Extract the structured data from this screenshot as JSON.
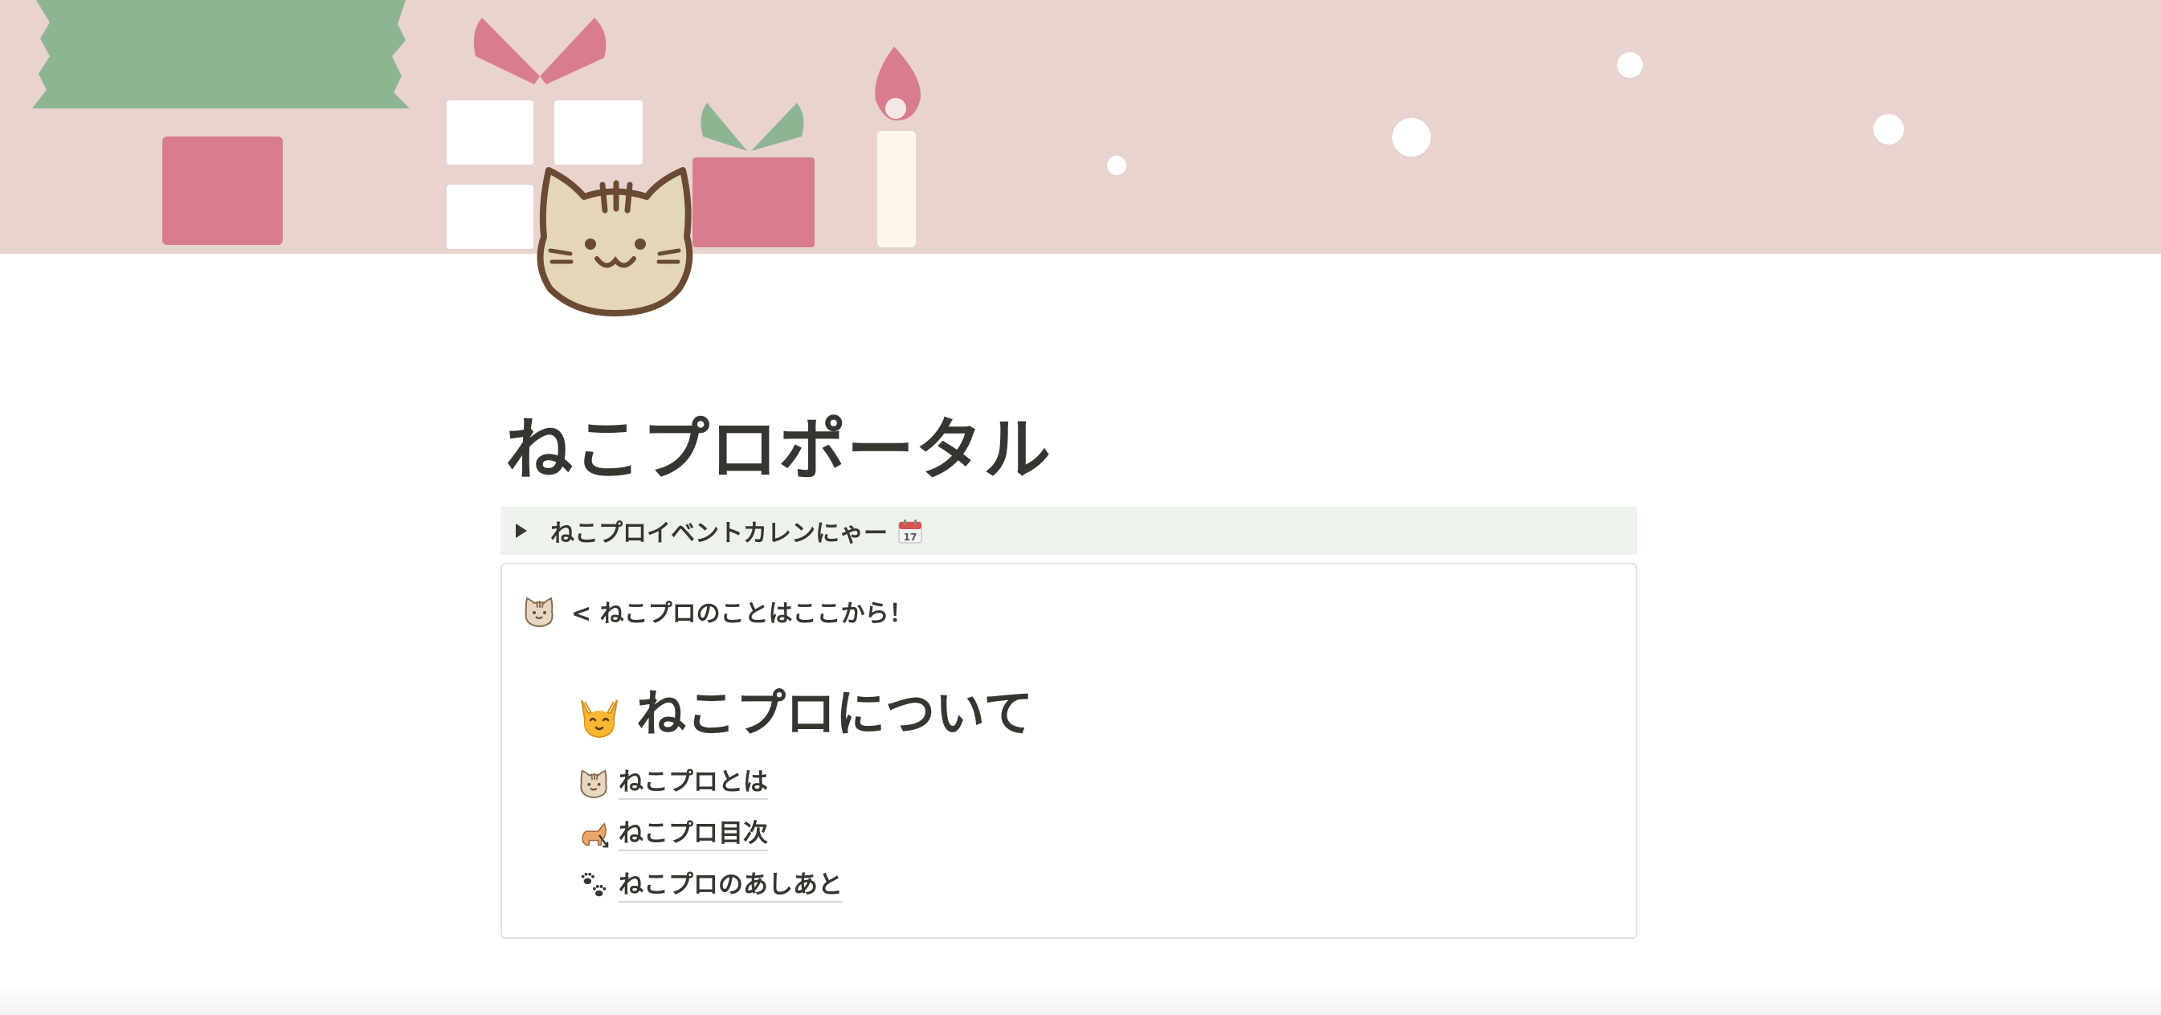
{
  "page": {
    "title": "ねこプロポータル"
  },
  "toggle": {
    "label": "ねこプロイベントカレンにゃー",
    "icon": "calendar-icon"
  },
  "callout": {
    "icon": "cat-face-icon",
    "text": "< ねこプロのことはここから！"
  },
  "section": {
    "heading": "ねこプロについて",
    "heading_icon": "cat-face-icon",
    "links": [
      {
        "icon": "cat-face-icon",
        "label": "ねこプロとは"
      },
      {
        "icon": "cat-link-icon",
        "label": "ねこプロ目次"
      },
      {
        "icon": "paw-prints-icon",
        "label": "ねこプロのあしあと"
      }
    ]
  },
  "colors": {
    "cover_bg": "#e9d3cf",
    "tree_green": "#8db592",
    "gift_pink": "#d87d8c",
    "toggle_bg": "#edf3ec",
    "text": "#37352f"
  }
}
